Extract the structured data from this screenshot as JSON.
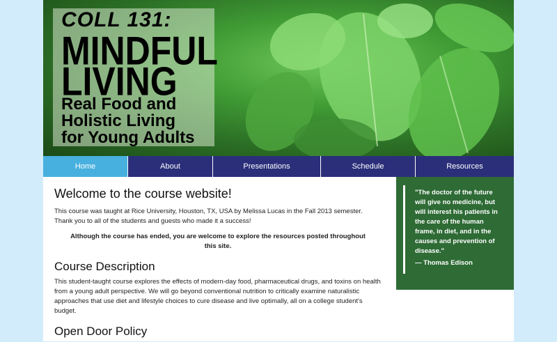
{
  "banner": {
    "code": "COLL 131:",
    "title_line1": "MINDFUL",
    "title_line2": "LIVING",
    "subtitle_line1": "Real Food and",
    "subtitle_line2": "Holistic Living",
    "subtitle_line3": "for Young Adults"
  },
  "nav": {
    "items": [
      {
        "label": "Home"
      },
      {
        "label": "About"
      },
      {
        "label": "Presentations"
      },
      {
        "label": "Schedule"
      },
      {
        "label": "Resources"
      }
    ],
    "active_color": "#48b0de",
    "bar_color": "#2b2f7a"
  },
  "main": {
    "welcome_heading": "Welcome to the course website!",
    "welcome_text": "This course was taught at Rice University, Houston, TX, USA by Melissa Lucas in the Fall 2013 semester. Thank you to all of the students and guests who made it a success!",
    "notice": "Although the course has ended, you are welcome to explore the resources posted throughout this site.",
    "description_heading": "Course Description",
    "description_text": "This student-taught course explores the effects of modern-day food, pharmaceutical drugs, and toxins on health from a young adult perspective. We will go beyond conventional nutrition to critically examine naturalistic approaches that use diet and lifestyle choices to cure disease and live optimally, all on a college student's budget.",
    "policy_heading": "Open Door Policy"
  },
  "sidebar": {
    "quote": "\"The doctor of the future will give no medicine, but will interest his patients in the care of the human frame, in diet, and in the causes and prevention of disease.\"",
    "author": "— Thomas Edison",
    "box_color": "#2e6b35"
  }
}
